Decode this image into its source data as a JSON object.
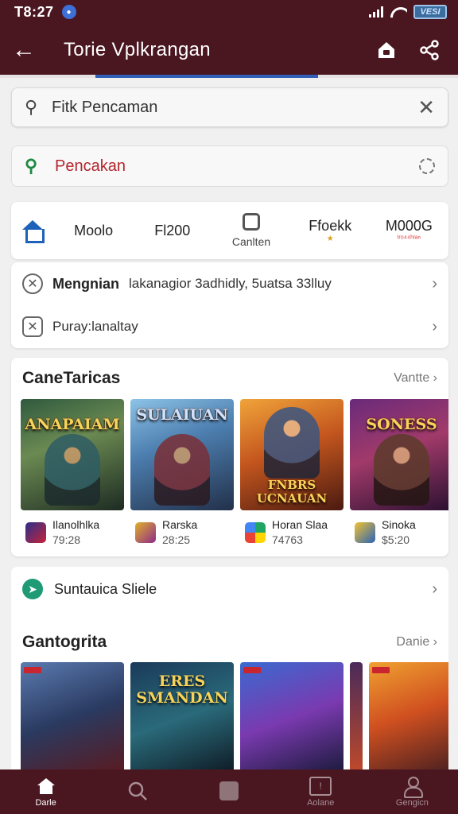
{
  "status_bar": {
    "time": "T8:27",
    "notification_icon": "circle-badge-icon",
    "battery_label": "VESI"
  },
  "app_bar": {
    "title": "Torie Vplkrangan",
    "back_icon": "arrow-left-icon",
    "actions": [
      "home-lock-icon",
      "share-icon"
    ]
  },
  "search": {
    "value": "Fitk Pencaman",
    "placeholder": "Fitk Pencaman",
    "search_icon": "search-icon",
    "clear_icon": "close-icon"
  },
  "query": {
    "text": "Pencakan",
    "icon": "search-icon",
    "status_icon": "loading-icon"
  },
  "category_tabs": [
    {
      "label": "Moolo",
      "sub": ""
    },
    {
      "label": "Fl200",
      "sub": ""
    },
    {
      "label": "",
      "sub": "Canlten"
    },
    {
      "label": "Ffoekk",
      "sub": "★"
    },
    {
      "label": "M000G",
      "sub": "ᴵʳᵒ⁴⁴ʰᴵᵃⁿ"
    }
  ],
  "menu": {
    "row1": {
      "bold": "Mengnian",
      "text": "lakanagior 3adhidly, 5uatsa 33lluy"
    },
    "row2": {
      "text": "Puray:lanaltay"
    }
  },
  "section1": {
    "title": "CaneTaricas",
    "more": "Vantte ›",
    "games": [
      {
        "art_title": "ANAPAIAM",
        "name": "Ilanolhlka",
        "price": "79:28"
      },
      {
        "art_title": "SULAIUAN",
        "name": "Rarska",
        "price": "28:25"
      },
      {
        "art_title": "FNBRS UCNAUAN",
        "name": "Horan Slaa",
        "price": "74763"
      },
      {
        "art_title": "SONESS",
        "name": "Sinoka",
        "price": "$5:20"
      }
    ]
  },
  "suggest": {
    "text": "Suntauica Sliele"
  },
  "section2": {
    "title": "Gantogrita",
    "more": "Danie ›",
    "games": [
      {
        "art_title": ""
      },
      {
        "art_title": "ERES SMANDAN"
      },
      {
        "art_title": ""
      },
      {
        "art_title": ""
      },
      {
        "art_title": ""
      }
    ]
  },
  "bottom_nav": [
    {
      "label": "Darle",
      "icon": "home-icon",
      "active": true
    },
    {
      "label": "",
      "icon": "search-icon",
      "active": false
    },
    {
      "label": "",
      "icon": "square-icon",
      "active": false
    },
    {
      "label": "Aolane",
      "icon": "apps-box-icon",
      "active": false
    },
    {
      "label": "Gengicn",
      "icon": "person-icon",
      "active": false
    }
  ]
}
